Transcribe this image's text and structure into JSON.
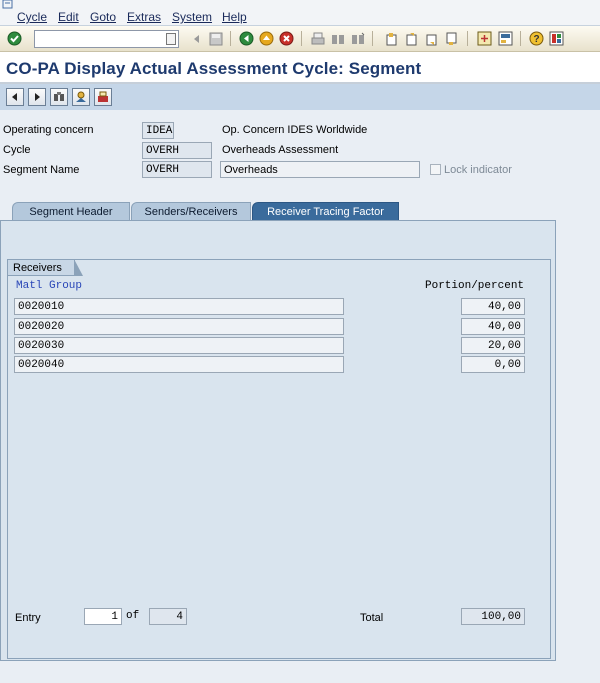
{
  "menu": {
    "items": [
      {
        "label": "Cycle"
      },
      {
        "label": "Edit"
      },
      {
        "label": "Goto"
      },
      {
        "label": "Extras"
      },
      {
        "label": "System"
      },
      {
        "label": "Help"
      }
    ]
  },
  "toolbar": {
    "command_field_value": "",
    "icons": [
      "enter-icon",
      "back-nav-icon",
      "save-icon",
      "back-icon",
      "exit-icon",
      "cancel-icon",
      "print-icon",
      "find-icon",
      "find-next-icon",
      "first-page-icon",
      "previous-page-icon",
      "next-page-icon",
      "last-page-icon",
      "create-session-icon",
      "shortcut-icon",
      "help-icon",
      "layout-icon"
    ]
  },
  "title": "CO-PA Display Actual Assessment Cycle: Segment",
  "app_toolbar": {
    "icons": [
      "previous-segment-icon",
      "next-segment-icon",
      "find-segment-icon",
      "overview-icon",
      "delete-icon"
    ]
  },
  "header": {
    "operating_concern": {
      "label": "Operating concern",
      "value": "IDEA",
      "description": "Op. Concern IDES Worldwide"
    },
    "cycle": {
      "label": "Cycle",
      "value": "OVERH",
      "description": "Overheads Assessment"
    },
    "segment": {
      "label": "Segment Name",
      "value": "OVERH",
      "description": "Overheads"
    },
    "lock_indicator": {
      "label": "Lock indicator",
      "checked": false
    }
  },
  "tabs": [
    {
      "label": "Segment Header",
      "active": false
    },
    {
      "label": "Senders/Receivers",
      "active": false
    },
    {
      "label": "Receiver Tracing Factor",
      "active": true
    }
  ],
  "receivers": {
    "group_title": "Receivers",
    "col_left": "Matl Group",
    "col_right": "Portion/percent",
    "rows": [
      {
        "group": "0020010",
        "portion": "40,00"
      },
      {
        "group": "0020020",
        "portion": "40,00"
      },
      {
        "group": "0020030",
        "portion": "20,00"
      },
      {
        "group": "0020040",
        "portion": "0,00"
      }
    ],
    "entry_label": "Entry",
    "entry_value": "1",
    "of_label": "of",
    "of_value": "4",
    "total_label": "Total",
    "total_value": "100,00"
  }
}
